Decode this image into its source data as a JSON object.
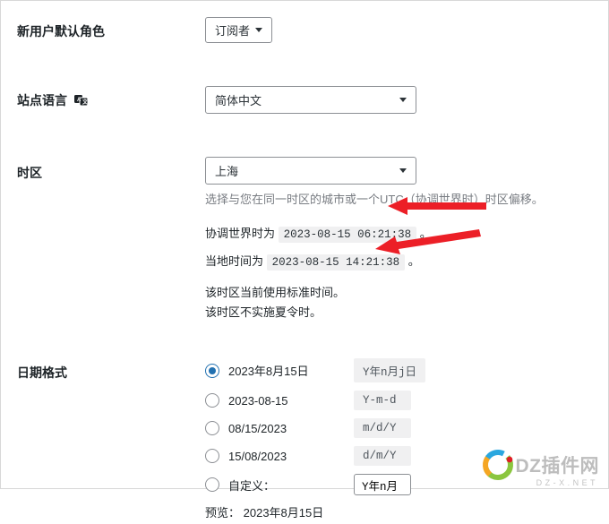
{
  "default_role": {
    "label": "新用户默认角色",
    "selected": "订阅者"
  },
  "site_language": {
    "label": "站点语言",
    "selected": "简体中文"
  },
  "timezone": {
    "label": "时区",
    "selected": "上海",
    "description": "选择与您在同一时区的城市或一个UTC（协调世界时）时区偏移。",
    "utc_prefix": "协调世界时为",
    "utc_value": "2023-08-15 06:21:38",
    "utc_suffix": "。",
    "local_prefix": "当地时间为",
    "local_value": "2023-08-15 14:21:38",
    "local_suffix": "。",
    "note_standard": "该时区当前使用标准时间。",
    "note_dst": "该时区不实施夏令时。"
  },
  "date_format": {
    "label": "日期格式",
    "options": [
      {
        "display": "2023年8月15日",
        "code": "Y年n月j日",
        "checked": true
      },
      {
        "display": "2023-08-15",
        "code": "Y-m-d",
        "checked": false
      },
      {
        "display": "08/15/2023",
        "code": "m/d/Y",
        "checked": false
      },
      {
        "display": "15/08/2023",
        "code": "d/m/Y",
        "checked": false
      }
    ],
    "custom_label": "自定义：",
    "custom_value": "Y年n月",
    "preview_label": "预览：",
    "preview_value": "2023年8月15日"
  },
  "watermark": {
    "text": "DZ插件网",
    "sub": "D Z - X . N E T"
  }
}
